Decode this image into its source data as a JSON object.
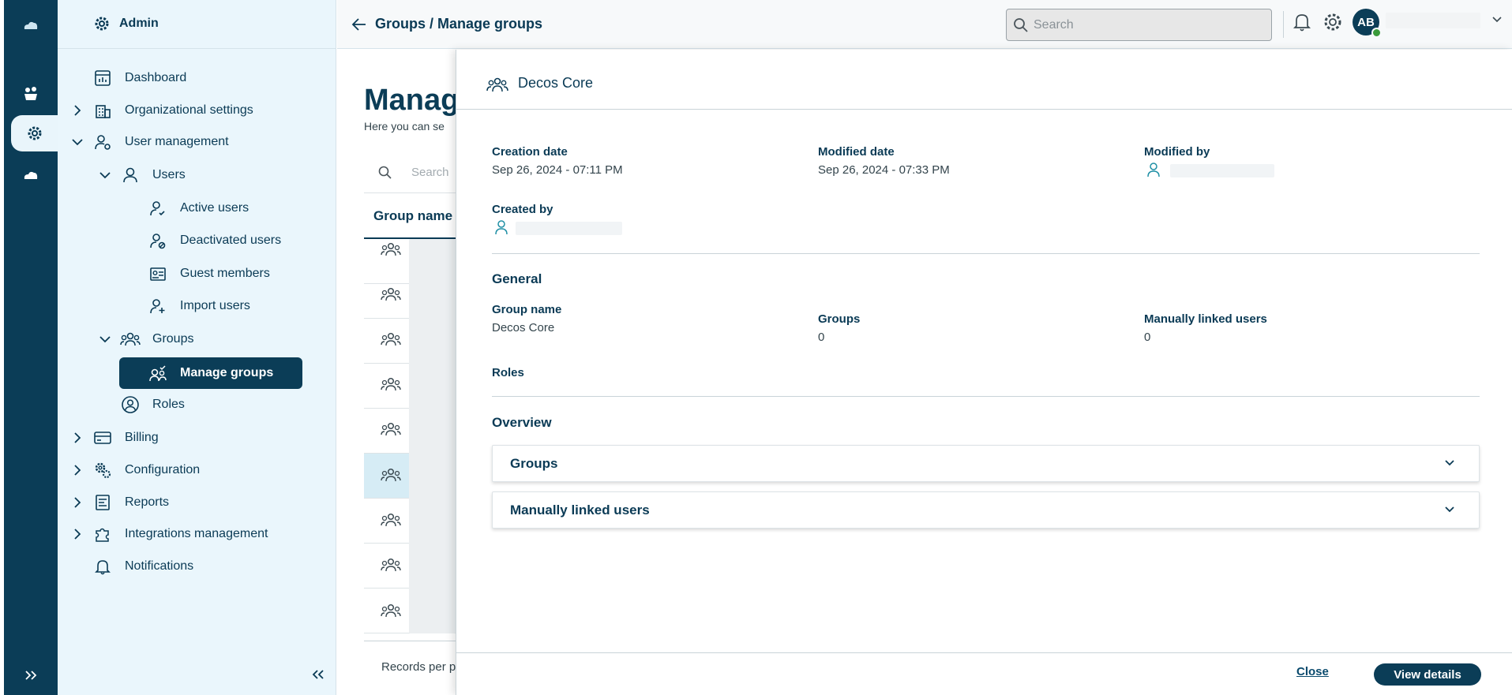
{
  "sidebar": {
    "header": "Admin",
    "items": [
      {
        "label": "Dashboard"
      },
      {
        "label": "Organizational settings"
      },
      {
        "label": "User management"
      },
      {
        "label": "Users"
      },
      {
        "label": "Active users"
      },
      {
        "label": "Deactivated users"
      },
      {
        "label": "Guest members"
      },
      {
        "label": "Import users"
      },
      {
        "label": "Groups"
      },
      {
        "label": "Manage groups"
      },
      {
        "label": "Roles"
      },
      {
        "label": "Billing"
      },
      {
        "label": "Configuration"
      },
      {
        "label": "Reports"
      },
      {
        "label": "Integrations management"
      },
      {
        "label": "Notifications"
      }
    ]
  },
  "topbar": {
    "breadcrumb": "Groups / Manage groups",
    "search_placeholder": "Search",
    "avatar_initials": "AB"
  },
  "main": {
    "title": "Manag",
    "subtitle": "Here you can se",
    "search_placeholder": "Search",
    "column_group_name": "Group name",
    "records_per_page": "Records per p"
  },
  "panel": {
    "title": "Decos Core",
    "creation_date_label": "Creation date",
    "creation_date_value": "Sep 26, 2024 - 07:11 PM",
    "modified_date_label": "Modified date",
    "modified_date_value": "Sep 26, 2024 - 07:33 PM",
    "modified_by_label": "Modified by",
    "created_by_label": "Created by",
    "general_heading": "General",
    "group_name_label": "Group name",
    "group_name_value": "Decos Core",
    "groups_label": "Groups",
    "groups_value": "0",
    "manually_linked_label": "Manually linked users",
    "manually_linked_value": "0",
    "roles_label": "Roles",
    "overview_heading": "Overview",
    "accordion_groups": "Groups",
    "accordion_users": "Manually linked users",
    "close_label": "Close",
    "view_details_label": "View details"
  },
  "colors": {
    "brand_dark": "#0b3d57",
    "sidebar_bg": "#eaf6fc",
    "accent_teal": "#1f8fa5"
  }
}
